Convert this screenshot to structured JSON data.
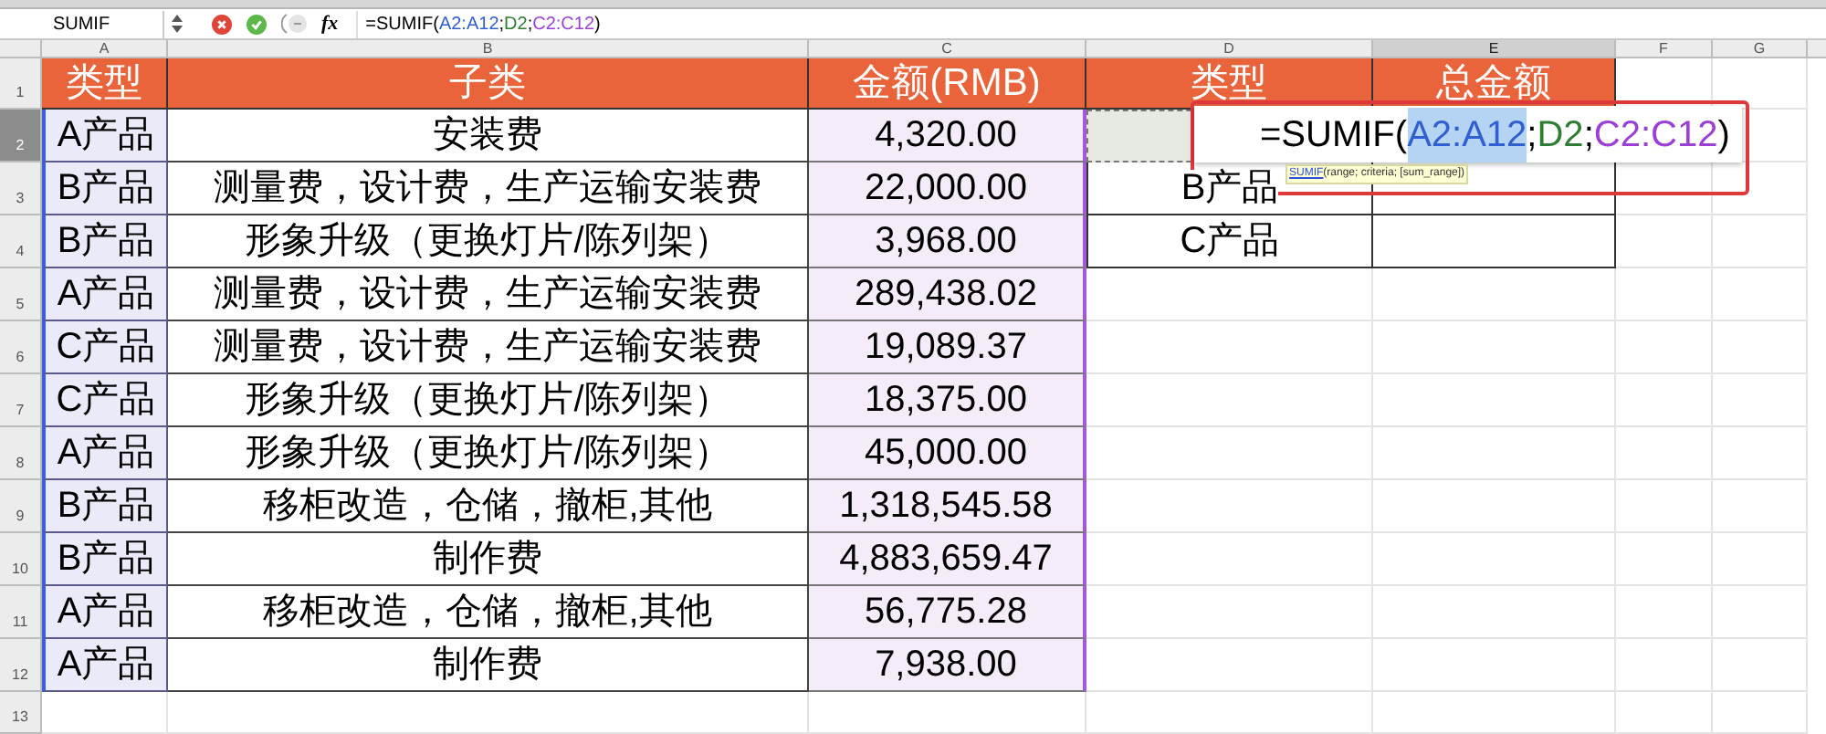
{
  "formula_bar": {
    "name_box": "SUMIF",
    "fx": "fx",
    "formula": [
      {
        "text": "=SUMIF(",
        "color": "#000000"
      },
      {
        "text": "A2:A12",
        "color": "#2f5fd0"
      },
      {
        "text": ";",
        "color": "#000000"
      },
      {
        "text": "D2",
        "color": "#2e7d32"
      },
      {
        "text": ";",
        "color": "#000000"
      },
      {
        "text": "C2:C12",
        "color": "#9b3fd6"
      },
      {
        "text": ")",
        "color": "#000000"
      }
    ]
  },
  "columns": [
    {
      "label": "A",
      "selected": false
    },
    {
      "label": "B",
      "selected": false
    },
    {
      "label": "C",
      "selected": false
    },
    {
      "label": "D",
      "selected": false
    },
    {
      "label": "E",
      "selected": true
    },
    {
      "label": "F",
      "selected": false
    },
    {
      "label": "G",
      "selected": false
    }
  ],
  "row_numbers": [
    {
      "label": "1",
      "selected": false
    },
    {
      "label": "2",
      "selected": true
    },
    {
      "label": "3",
      "selected": false
    },
    {
      "label": "4",
      "selected": false
    },
    {
      "label": "5",
      "selected": false
    },
    {
      "label": "6",
      "selected": false
    },
    {
      "label": "7",
      "selected": false
    },
    {
      "label": "8",
      "selected": false
    },
    {
      "label": "9",
      "selected": false
    },
    {
      "label": "10",
      "selected": false
    },
    {
      "label": "11",
      "selected": false
    },
    {
      "label": "12",
      "selected": false
    },
    {
      "label": "13",
      "selected": false
    }
  ],
  "data_table": {
    "header": [
      "类型",
      "子类",
      "金额(RMB)"
    ],
    "rows": [
      [
        "A产品",
        "安装费",
        "4,320.00"
      ],
      [
        "B产品",
        "测量费，设计费，生产运输安装费",
        "22,000.00"
      ],
      [
        "B产品",
        "形象升级（更换灯片/陈列架）",
        "3,968.00"
      ],
      [
        "A产品",
        "测量费，设计费，生产运输安装费",
        "289,438.02"
      ],
      [
        "C产品",
        "测量费，设计费，生产运输安装费",
        "19,089.37"
      ],
      [
        "C产品",
        "形象升级（更换灯片/陈列架）",
        "18,375.00"
      ],
      [
        "A产品",
        "形象升级（更换灯片/陈列架）",
        "45,000.00"
      ],
      [
        "B产品",
        "移柜改造，仓储，撤柜,其他",
        "1,318,545.58"
      ],
      [
        "B产品",
        "制作费",
        "4,883,659.47"
      ],
      [
        "A产品",
        "移柜改造，仓储，撤柜,其他",
        "56,775.28"
      ],
      [
        "A产品",
        "制作费",
        "7,938.00"
      ]
    ]
  },
  "summary_table": {
    "header": [
      "类型",
      "总金额"
    ],
    "rows": [
      {
        "type": "B产品"
      },
      {
        "type": "C产品"
      }
    ]
  },
  "cell_editor": {
    "formula": [
      {
        "text": "=SUMIF(",
        "color": "#000000",
        "selected": false
      },
      {
        "text": "A2:A12",
        "color": "#2f5fd0",
        "selected": true
      },
      {
        "text": ";",
        "color": "#000000",
        "selected": false
      },
      {
        "text": "D2",
        "color": "#2e7d32",
        "selected": false
      },
      {
        "text": ";",
        "color": "#000000",
        "selected": false
      },
      {
        "text": "C2:C12",
        "color": "#9b3fd6",
        "selected": false
      },
      {
        "text": ")",
        "color": "#000000",
        "selected": false
      }
    ],
    "tooltip": {
      "function": "SUMIF",
      "arguments": "(range; criteria; [sum_range])"
    }
  }
}
